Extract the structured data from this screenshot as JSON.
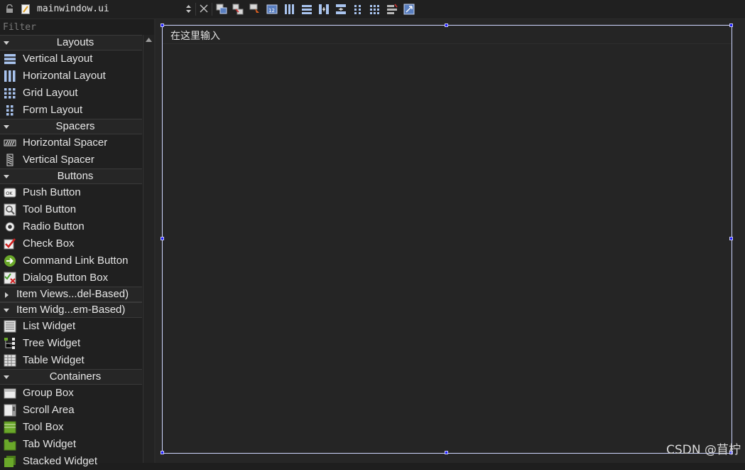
{
  "toolbar": {
    "file_name": "mainwindow.ui",
    "icons": [
      "lock-icon",
      "file-icon",
      "edit-widgets-icon",
      "edit-signals-slots-icon",
      "edit-buddies-icon",
      "edit-tab-order-icon",
      "layout-horizontal-icon",
      "layout-vertical-icon",
      "layout-horizontal-splitter-icon",
      "layout-vertical-splitter-icon",
      "layout-form-icon",
      "layout-grid-icon",
      "break-layout-icon",
      "adjust-size-icon"
    ]
  },
  "widget_box": {
    "filter_placeholder": "Filter",
    "categories": {
      "layouts": "Layouts",
      "spacers": "Spacers",
      "buttons": "Buttons",
      "item_views": "Item Views...del-Based)",
      "item_widgets": "Item Widg...em-Based)",
      "containers": "Containers"
    },
    "items": {
      "vertical_layout": "Vertical Layout",
      "horizontal_layout": "Horizontal Layout",
      "grid_layout": "Grid Layout",
      "form_layout": "Form Layout",
      "horizontal_spacer": "Horizontal Spacer",
      "vertical_spacer": "Vertical Spacer",
      "push_button": "Push Button",
      "tool_button": "Tool Button",
      "radio_button": "Radio Button",
      "check_box": "Check Box",
      "command_link_button": "Command Link Button",
      "dialog_button_box": "Dialog Button Box",
      "list_widget": "List Widget",
      "tree_widget": "Tree Widget",
      "table_widget": "Table Widget",
      "group_box": "Group Box",
      "scroll_area": "Scroll Area",
      "tool_box": "Tool Box",
      "tab_widget": "Tab Widget",
      "stacked_widget": "Stacked Widget"
    }
  },
  "form": {
    "text_edit_content": "在这里输入"
  },
  "watermark": "CSDN @苜柠",
  "colors": {
    "background": "#1e1e1e",
    "selection_handle": "#1c1cff",
    "form_border": "#cfd6ff"
  }
}
